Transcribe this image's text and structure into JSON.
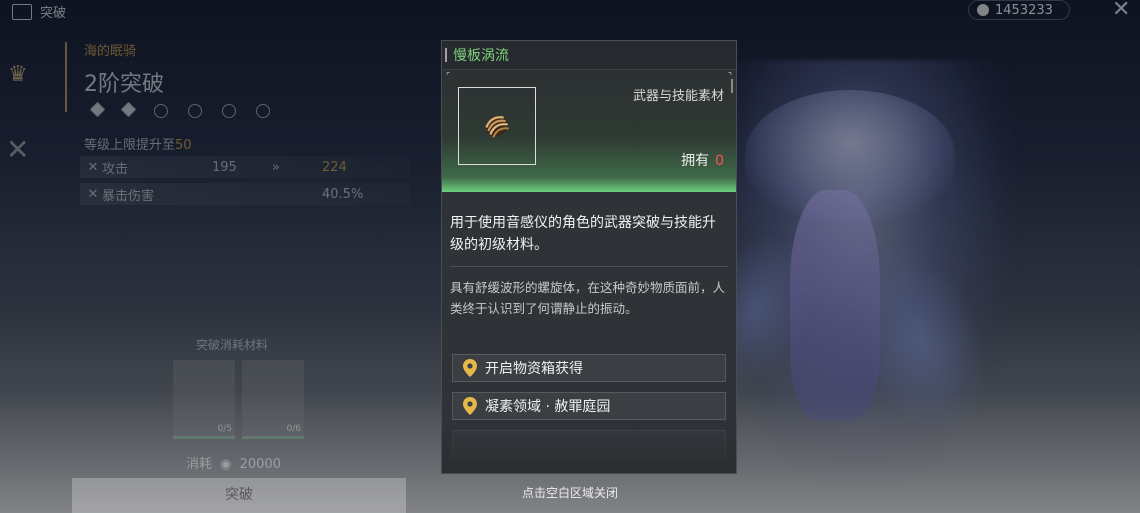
{
  "topbar": {
    "section_label": "突破",
    "currency_value": "1453233",
    "close_icon": "close-x-icon"
  },
  "left_panel": {
    "weapon_name": "海的眠骑",
    "ascend_title": "2阶突破",
    "level_line_prefix": "等级上限提升至",
    "level_line_value": "50",
    "stats": [
      {
        "name": "攻击",
        "from": "195",
        "to": "224"
      },
      {
        "name": "暴击伤害",
        "from": "",
        "to": "40.5%"
      }
    ],
    "materials_label": "突破消耗材料",
    "materials": [
      {
        "count": "0/5"
      },
      {
        "count": "0/6"
      }
    ],
    "cost_label": "消耗",
    "cost_value": "20000",
    "ascend_button": "突破"
  },
  "card": {
    "title": "慢板涡流",
    "category": "武器与技能素材",
    "owned_label": "拥有",
    "owned_value": "0",
    "description": "用于使用音感仪的角色的武器突破与技能升级的初级材料。",
    "lore": "具有舒缓波形的螺旋体，在这种奇妙物质面前，人类终于认识到了何谓静止的振动。",
    "sources": [
      {
        "label": "开启物资箱获得",
        "icon": "location-pin-icon"
      },
      {
        "label": "凝素领域 · 赦罪庭园",
        "icon": "location-pin-icon"
      }
    ],
    "accent_color": "#7fd07a",
    "owned_color": "#ff5050"
  },
  "hint": "点击空白区域关闭"
}
